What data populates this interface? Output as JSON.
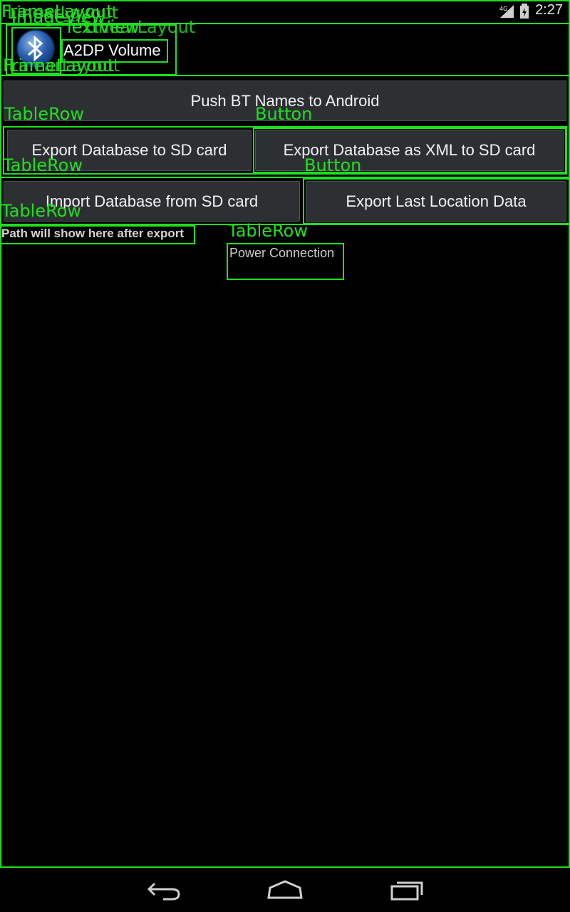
{
  "status_bar": {
    "time": "2:27",
    "network": "4G"
  },
  "app": {
    "title": "A2DP Volume",
    "icon": "bluetooth-icon"
  },
  "buttons": {
    "push_bt_names": "Push BT Names to Android",
    "export_db_sd": "Export Database to SD card",
    "export_db_xml": "Export Database as XML to SD card",
    "import_db_sd": "Import Database from SD card",
    "export_last_location": "Export Last Location Data"
  },
  "texts": {
    "path_hint": "Path will show here after export",
    "power_connection": "Power Connection"
  },
  "overlay_labels": {
    "framelayout": "FrameLayout",
    "linearlayout": "LinearLayout",
    "imageview": "ImageView",
    "textview": "TextView",
    "tablerow": "TableRow",
    "button": "Button"
  },
  "colors": {
    "overlay": "#1fe01f",
    "background": "#000000",
    "button": "#2c3033"
  }
}
